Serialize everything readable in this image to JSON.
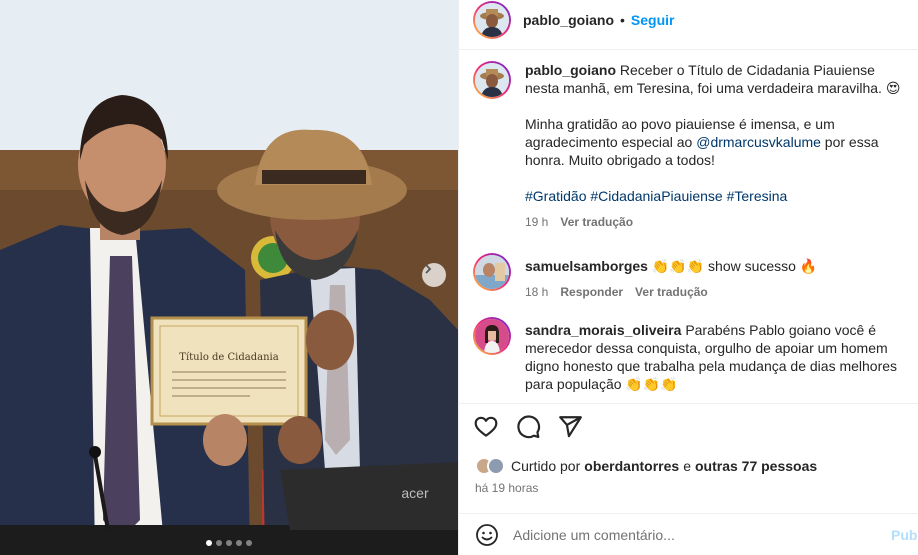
{
  "post": {
    "author": "pablo_goiano",
    "separator": "•",
    "follow_label": "Seguir"
  },
  "caption": {
    "username": "pablo_goiano",
    "line1_text": "Receber o Título de Cidadania Piauiense nesta manhã, em Teresina, foi uma verdadeira maravilha. 😍",
    "line2_before": "Minha gratidão ao povo piauiense é imensa, e um agradecimento especial ao ",
    "line2_mention": "@drmarcusvkalume",
    "line2_after": " por essa honra. Muito obrigado a todos!",
    "hashtags": "#Gratidão #CidadaniaPiauiense #Teresina",
    "time": "19 h",
    "translate": "Ver tradução"
  },
  "comments": [
    {
      "username": "samuelsamborges",
      "text": "👏👏👏 show sucesso 🔥",
      "time": "18 h",
      "reply": "Responder",
      "translate": "Ver tradução"
    },
    {
      "username": "sandra_morais_oliveira",
      "text": "Parabéns Pablo goiano você é merecedor dessa conquista, orgulho de apoiar um homem digno honesto que trabalha pela mudança de dias melhores para população 👏👏👏"
    }
  ],
  "likes": {
    "prefix": "Curtido por",
    "user": "oberdantorres",
    "connector": "e",
    "others": "outras 77 pessoas"
  },
  "post_time": "há 19 horas",
  "add_comment": {
    "placeholder": "Adicione um comentário...",
    "publish": "Publicar"
  },
  "photo": {
    "certificate_title": "Título de Cidadania",
    "laptop_brand": "acer",
    "carousel": {
      "count": 5,
      "active_index": 0
    }
  },
  "colors": {
    "accent": "#0095f6",
    "mention": "#00376b",
    "secondary_text": "#737373",
    "publish_disabled": "#b2dffc"
  },
  "icons": [
    "heart-icon",
    "comment-icon",
    "share-icon",
    "emoji-icon",
    "chevron-right-icon"
  ]
}
